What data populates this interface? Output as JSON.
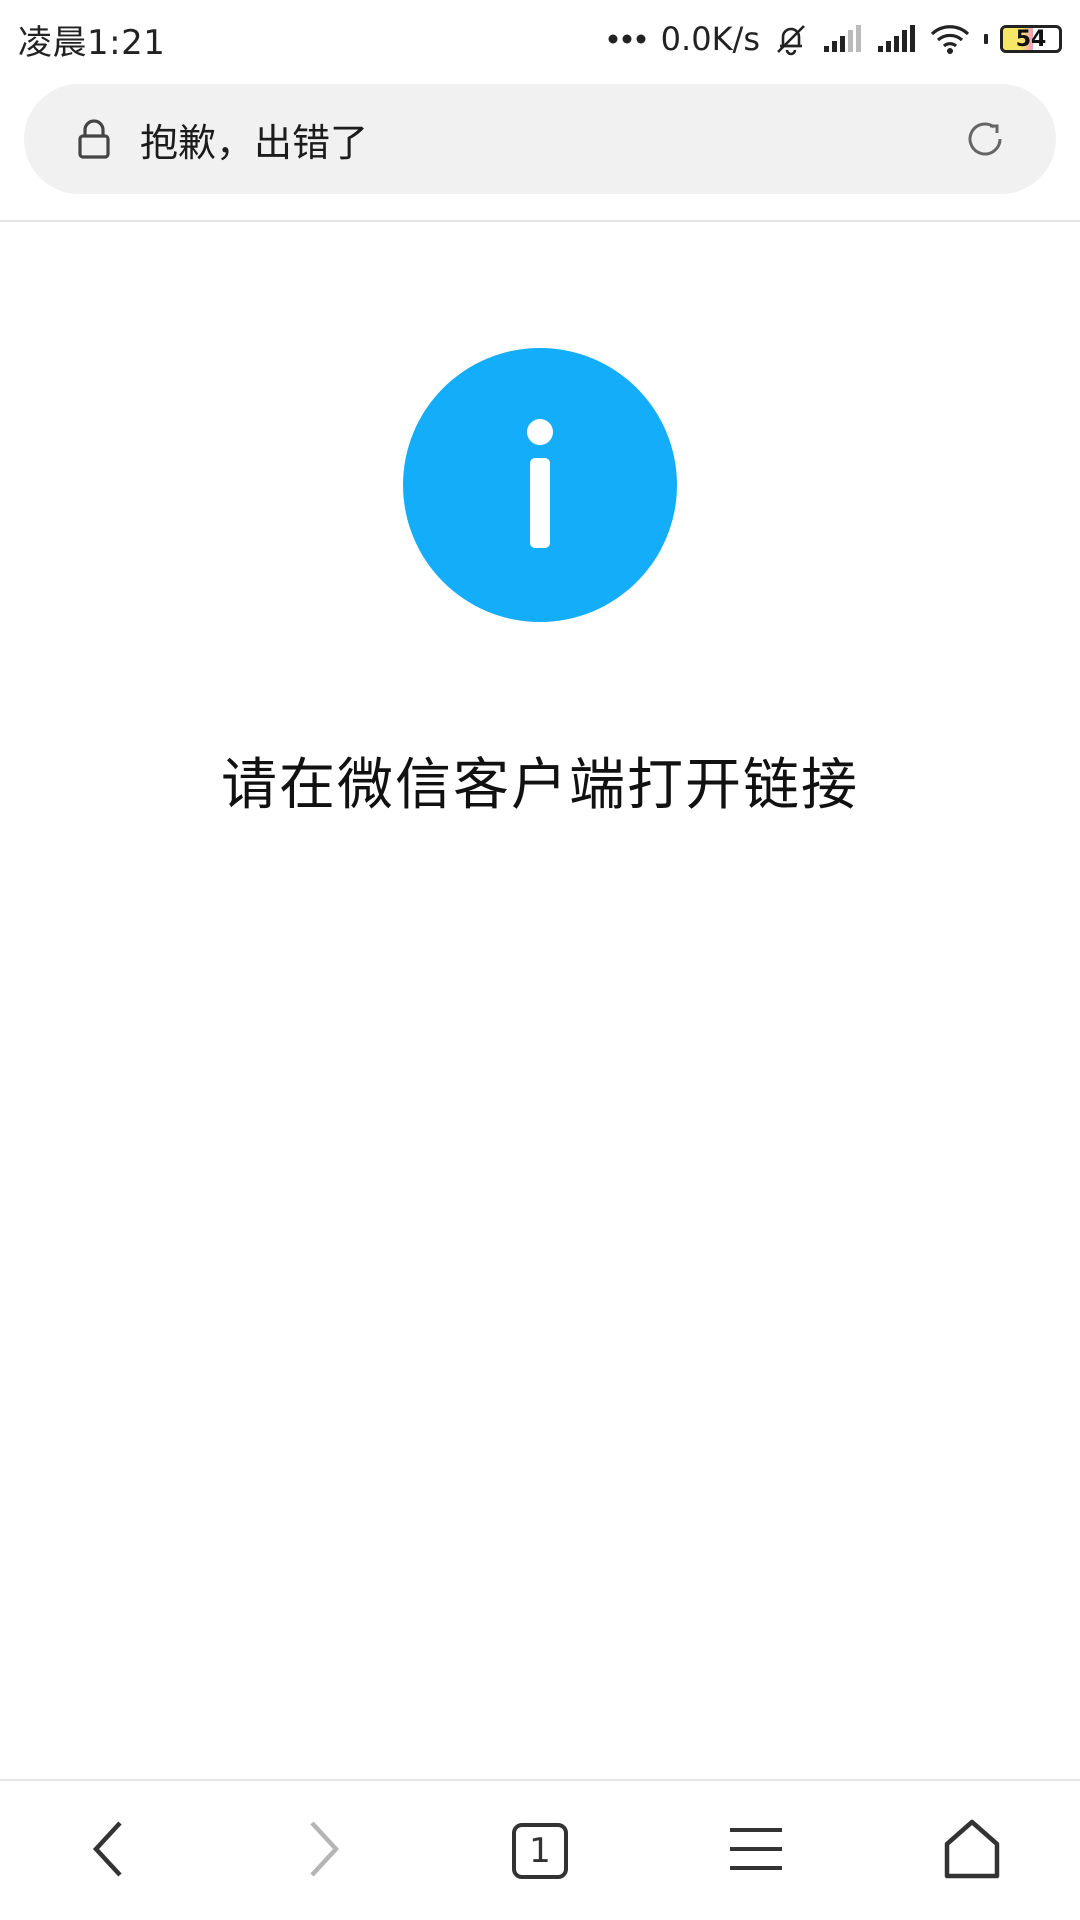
{
  "status_bar": {
    "time": "凌晨1:21",
    "network_speed": "0.0K/s",
    "battery_level": "54",
    "battery_fraction": 0.54,
    "icons": [
      "more-dots-icon",
      "mute-bell-icon",
      "signal-1-icon",
      "signal-2-icon",
      "wifi-icon",
      "battery-icon"
    ]
  },
  "address_bar": {
    "title": "抱歉，出错了",
    "left_icon": "lock-icon",
    "right_icon": "refresh-icon"
  },
  "content": {
    "icon": "info-icon",
    "icon_color": "#13adfa",
    "message": "请在微信客户端打开链接"
  },
  "bottom_nav": {
    "tab_count": "1",
    "items": [
      "back-icon",
      "forward-icon",
      "tabs-icon",
      "menu-icon",
      "home-icon"
    ]
  }
}
